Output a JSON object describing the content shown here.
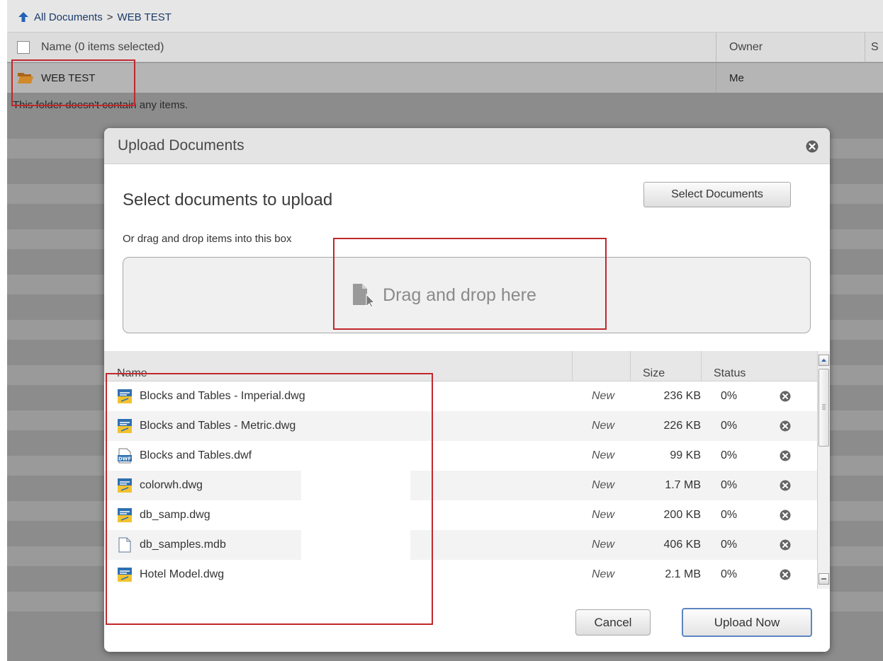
{
  "breadcrumb": {
    "root": "All Documents",
    "separator": ">",
    "current": "WEB TEST"
  },
  "list_header": {
    "name": "Name (0 items selected)",
    "owner": "Owner",
    "extra": "S"
  },
  "folder": {
    "name": "WEB TEST",
    "owner": "Me"
  },
  "empty_message": "This folder doesn't contain any items.",
  "dialog": {
    "title": "Upload Documents",
    "heading": "Select documents to upload",
    "select_button": "Select Documents",
    "drag_hint": "Or drag and drop items into this box",
    "drop_label": "Drag and drop here",
    "columns": {
      "name": "Name",
      "size": "Size",
      "status": "Status"
    },
    "files": [
      {
        "name": "Blocks and Tables - Imperial.dwg",
        "icon": "dwg-file-icon",
        "state": "New",
        "size": "236 KB",
        "status": "0%"
      },
      {
        "name": "Blocks and Tables - Metric.dwg",
        "icon": "dwg-file-icon",
        "state": "New",
        "size": "226 KB",
        "status": "0%"
      },
      {
        "name": "Blocks and Tables.dwf",
        "icon": "dwf-file-icon",
        "state": "New",
        "size": "99 KB",
        "status": "0%"
      },
      {
        "name": "colorwh.dwg",
        "icon": "dwg-file-icon",
        "state": "New",
        "size": "1.7 MB",
        "status": "0%"
      },
      {
        "name": "db_samp.dwg",
        "icon": "dwg-file-icon",
        "state": "New",
        "size": "200 KB",
        "status": "0%"
      },
      {
        "name": "db_samples.mdb",
        "icon": "generic-file-icon",
        "state": "New",
        "size": "406 KB",
        "status": "0%"
      },
      {
        "name": "Hotel Model.dwg",
        "icon": "dwg-file-icon",
        "state": "New",
        "size": "2.1 MB",
        "status": "0%"
      }
    ],
    "cancel_button": "Cancel",
    "upload_button": "Upload Now"
  },
  "colors": {
    "highlight": "#c0282d",
    "upload_border": "#5c86c0",
    "folder": "#d08a2a"
  }
}
